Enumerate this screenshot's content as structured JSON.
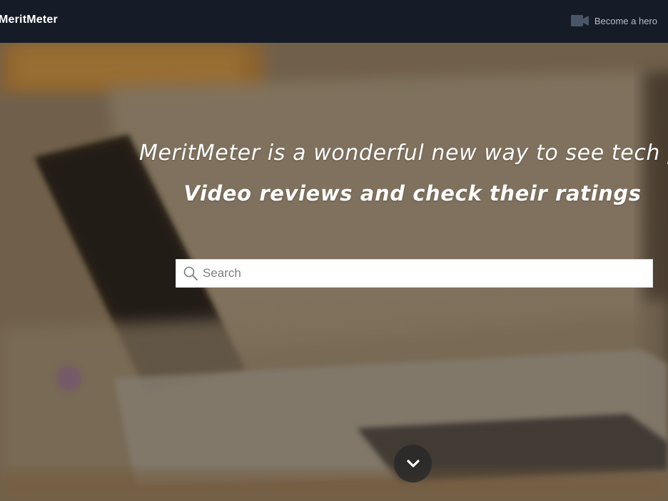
{
  "navbar": {
    "brand": "MeritMeter",
    "hero_link": {
      "label": "Become a hero",
      "icon": "video-camera-icon"
    }
  },
  "hero": {
    "headline": "MeritMeter is a wonderful new way to see tech produc",
    "subline": "Video reviews and check their ratings",
    "search": {
      "placeholder": "Search",
      "value": "",
      "icon": "search-icon"
    },
    "scroll_button": {
      "icon": "chevron-down-icon"
    }
  },
  "colors": {
    "navbar_bg": "#151b27",
    "link_text": "#b9bcc4",
    "hero_text": "#ffffff",
    "scroll_button_bg": "#282828"
  }
}
